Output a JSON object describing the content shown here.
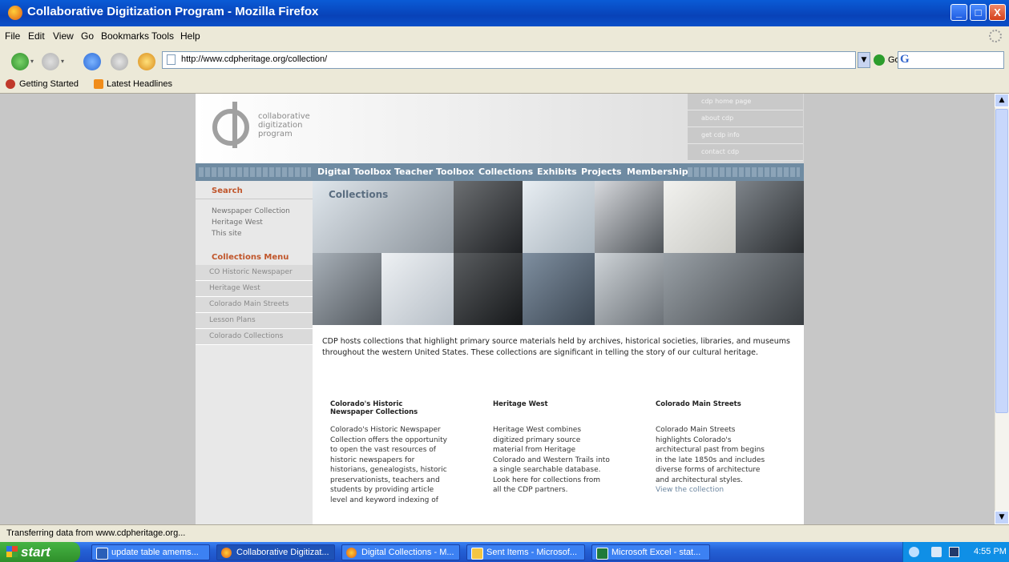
{
  "window": {
    "title": "Collaborative Digitization Program - Mozilla Firefox",
    "buttons": {
      "minimize": "_",
      "maximize": "□",
      "close": "X"
    }
  },
  "menu": [
    "File",
    "Edit",
    "View",
    "Go",
    "Bookmarks",
    "Tools",
    "Help"
  ],
  "toolbar": {
    "url": "http://www.cdpheritage.org/collection/",
    "go_label": "Go",
    "search_engine_icon": "G"
  },
  "bookmarks": [
    "Getting Started",
    "Latest Headlines"
  ],
  "site": {
    "logo_lines": [
      "collaborative",
      "digitization",
      "program"
    ],
    "top_links": [
      "cdp home page",
      "about cdp",
      "get cdp info",
      "contact cdp"
    ],
    "nav": [
      "Digital Toolbox",
      "Teacher Toolbox",
      "Collections",
      "Exhibits",
      "Projects",
      "Membership"
    ],
    "sidebar": {
      "search_head": "Search",
      "search_links": [
        "Newspaper Collection",
        "Heritage West",
        "This site"
      ],
      "menu_head": "Collections Menu",
      "menu_items": [
        "CO Historic Newspaper",
        "Heritage West",
        "Colorado Main Streets",
        "Lesson Plans",
        "Colorado Collections"
      ]
    },
    "collage_title": "Collections",
    "intro": "CDP hosts collections that highlight primary source materials held by archives, historical societies, libraries, and museums throughout the western United States. These collections are significant in telling the story of our cultural heritage.",
    "columns": [
      {
        "title": "Colorado's Historic Newspaper Collections",
        "body": "Colorado's Historic Newspaper Collection offers the opportunity to open the vast resources of historic newspapers for historians, genealogists, historic preservationists, teachers and students by providing article level and keyword indexing of"
      },
      {
        "title": "Heritage West",
        "body": "Heritage West combines digitized primary source material from Heritage Colorado and Western Trails into a single searchable database. Look here for collections from all the CDP partners."
      },
      {
        "title": "Colorado Main Streets",
        "body": "Colorado Main Streets highlights Colorado's architectural past from begins in the late 1850s and includes diverse forms of architecture and architectural styles.",
        "link": "View the collection"
      }
    ]
  },
  "status": "Transferring data from www.cdpheritage.org...",
  "taskbar": {
    "start": "start",
    "tasks": [
      "update table amems...",
      "Collaborative Digitizat...",
      "Digital Collections - M...",
      "Sent Items - Microsof...",
      "Microsoft Excel - stat..."
    ],
    "clock": "4:55 PM"
  }
}
